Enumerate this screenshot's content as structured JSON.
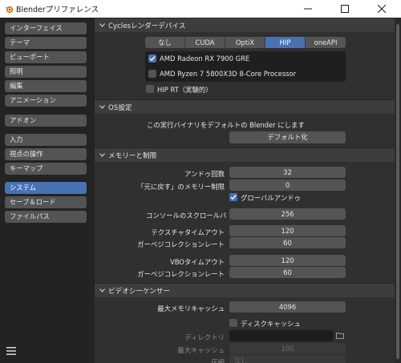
{
  "window": {
    "title": "Blenderプリファレンス",
    "icon": "blender-logo-icon",
    "controls": [
      "minimize-icon",
      "maximize-icon",
      "close-icon"
    ]
  },
  "sidebar": {
    "items": [
      {
        "label": "インターフェイス",
        "active": false
      },
      {
        "label": "テーマ",
        "active": false
      },
      {
        "label": "ビューポート",
        "active": false
      },
      {
        "label": "照明",
        "active": false
      },
      {
        "label": "編集",
        "active": false
      },
      {
        "label": "アニメーション",
        "active": false
      },
      {
        "label": "アドオン",
        "active": false
      },
      {
        "label": "入力",
        "active": false
      },
      {
        "label": "視点の操作",
        "active": false
      },
      {
        "label": "キーマップ",
        "active": false
      },
      {
        "label": "システム",
        "active": true
      },
      {
        "label": "セーブ＆ロード",
        "active": false
      },
      {
        "label": "ファイルパス",
        "active": false
      }
    ],
    "menu_icon": "hamburger-menu-icon"
  },
  "cycles": {
    "title": "Cyclesレンダーデバイス",
    "tabs": [
      "なし",
      "CUDA",
      "OptiX",
      "HIP",
      "oneAPI"
    ],
    "active_tab": "HIP",
    "devices": [
      {
        "label": "AMD Radeon RX 7900 GRE",
        "checked": true
      },
      {
        "label": "AMD Ryzen 7 5800X3D 8-Core Processor",
        "checked": false
      }
    ],
    "hip_rt_label": "HIP RT（実験的）",
    "hip_rt_checked": false
  },
  "os": {
    "title": "OS設定",
    "description": "この実行バイナリをデフォルトの Blender にします",
    "default_button": "デフォルト化"
  },
  "memory": {
    "title": "メモリーと制限",
    "undo_steps_label": "アンドゥ回数",
    "undo_steps_value": "32",
    "undo_memory_label": "「元に戻す」のメモリー制限",
    "undo_memory_value": "0",
    "global_undo_label": "グローバルアンドゥ",
    "global_undo_checked": true,
    "console_scrollback_label": "コンソールのスクロールバ...",
    "console_scrollback_value": "256",
    "texture_timeout_label": "テクスチャタイムアウト",
    "texture_timeout_value": "120",
    "texture_gc_label": "ガーベジコレクションレート",
    "texture_gc_value": "60",
    "vbo_timeout_label": "VBOタイムアウト",
    "vbo_timeout_value": "120",
    "vbo_gc_label": "ガーベジコレクションレート",
    "vbo_gc_value": "60"
  },
  "sequencer": {
    "title": "ビデオシーケンサー",
    "max_cache_label": "最大メモリキャッシュ",
    "max_cache_value": "4096",
    "disk_cache_label": "ディスクキャッシュ",
    "disk_cache_checked": false,
    "directory_label": "ディレクトリ",
    "directory_value": "",
    "directory_icon": "folder-icon",
    "disk_max_label": "最大キャッシュ",
    "disk_max_value": "100",
    "compression_label": "圧縮",
    "compression_value": "なし"
  }
}
